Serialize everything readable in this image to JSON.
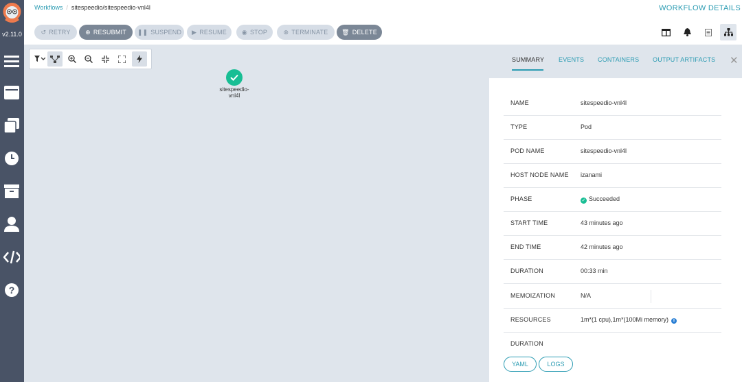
{
  "app": {
    "version": "v2.11.0",
    "nav": [
      "menu-icon",
      "workflow-templates-icon",
      "cluster-workflow-templates-icon",
      "cron-workflows-icon",
      "archived-workflows-icon",
      "user-icon",
      "api-docs-icon",
      "help-icon"
    ]
  },
  "breadcrumb": {
    "root": "Workflows",
    "separator": "/",
    "current": "sitespeedio/sitespeedio-vnl4l"
  },
  "page_title": "WORKFLOW DETAILS",
  "toolbar": {
    "retry": "RETRY",
    "resubmit": "RESUBMIT",
    "suspend": "SUSPEND",
    "resume": "RESUME",
    "stop": "STOP",
    "terminate": "TERMINATE",
    "delete": "DELETE"
  },
  "graph": {
    "node_label": "sitespeedio-vnl4l",
    "node_status": "Succeeded"
  },
  "panel": {
    "tabs": [
      "SUMMARY",
      "EVENTS",
      "CONTAINERS",
      "OUTPUT ARTIFACTS"
    ],
    "active_tab": "SUMMARY",
    "rows": [
      {
        "key": "NAME",
        "value": "sitespeedio-vnl4l"
      },
      {
        "key": "TYPE",
        "value": "Pod"
      },
      {
        "key": "POD NAME",
        "value": "sitespeedio-vnl4l"
      },
      {
        "key": "HOST NODE NAME",
        "value": "izanami"
      },
      {
        "key": "PHASE",
        "value": "Succeeded"
      },
      {
        "key": "START TIME",
        "value": "43 minutes ago"
      },
      {
        "key": "END TIME",
        "value": "42 minutes ago"
      },
      {
        "key": "DURATION",
        "value": "00:33 min"
      },
      {
        "key": "MEMOIZATION",
        "value": "N/A"
      },
      {
        "key": "RESOURCES",
        "value": "1m*(1 cpu),1m*(100Mi memory)"
      },
      {
        "key": "DURATION",
        "value": ""
      }
    ],
    "yaml_button": "YAML",
    "logs_button": "LOGS"
  },
  "colors": {
    "nav_bg": "#495366",
    "accent": "#2a9bb2",
    "success": "#18be94",
    "canvas_bg": "#dfe5ec"
  }
}
